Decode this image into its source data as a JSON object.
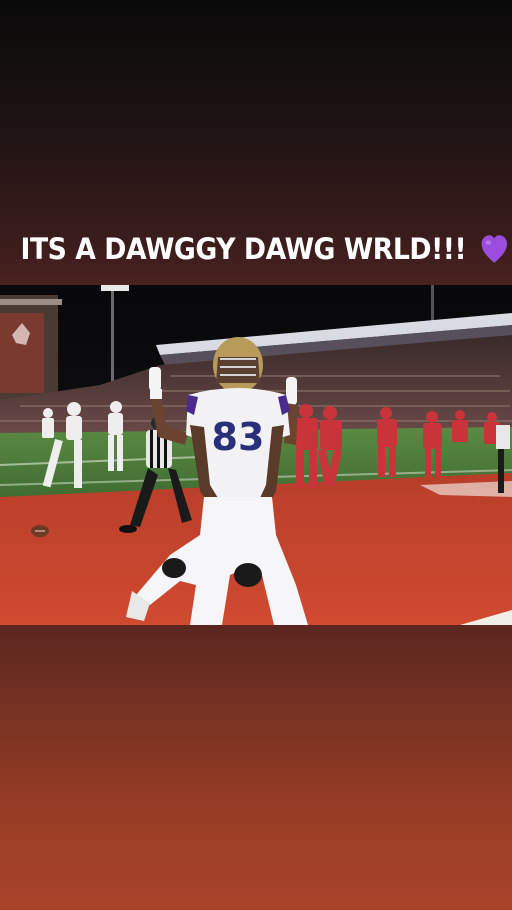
{
  "story": {
    "caption_text": "ITS A DAWGGY DAWG WRLD!!!",
    "emoji": "purple-heart",
    "emoji_color": "#9b4dde"
  },
  "photo": {
    "jersey_number": "83",
    "subject": "football-player-celebrating",
    "colors": {
      "turf": "#c7442c",
      "field": "#4c7a3a",
      "uniform": "#f2f2f4",
      "number": "#2a2f7a",
      "helmet": "#b89a5a"
    }
  },
  "background": {
    "top_color": "#0a0a0a",
    "bottom_color": "#a9442a"
  }
}
